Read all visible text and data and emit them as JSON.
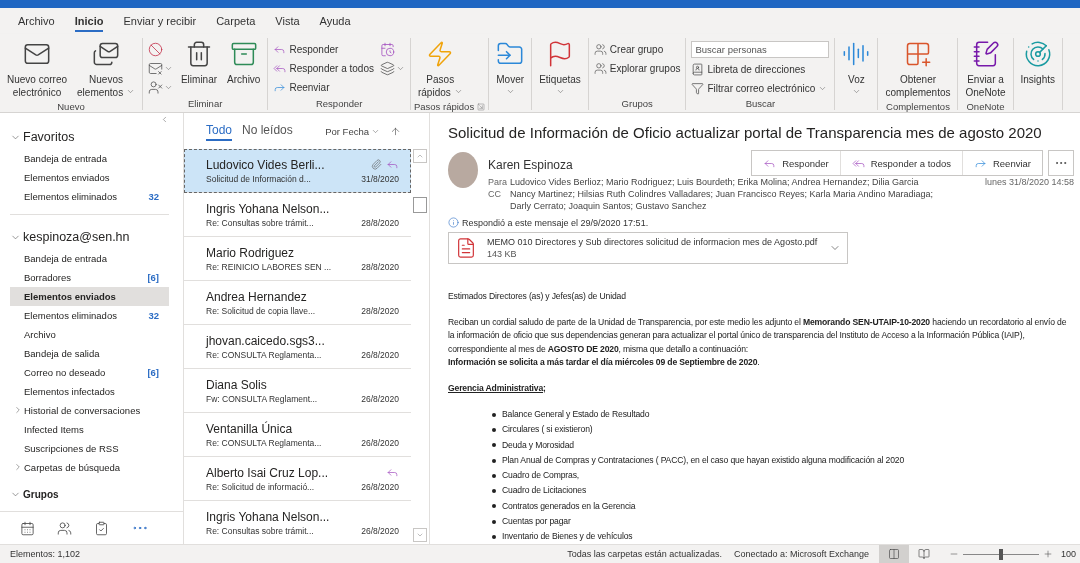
{
  "menu_tabs": [
    {
      "label": "Archivo",
      "selected": false
    },
    {
      "label": "Inicio",
      "selected": true
    },
    {
      "label": "Enviar y recibir",
      "selected": false
    },
    {
      "label": "Carpeta",
      "selected": false
    },
    {
      "label": "Vista",
      "selected": false
    },
    {
      "label": "Ayuda",
      "selected": false
    }
  ],
  "ribbon": [
    {
      "label": "Nuevo",
      "items": [
        {
          "kind": "large",
          "lines": [
            "Nuevo correo",
            "electrónico"
          ],
          "dropdown": false
        },
        {
          "kind": "large",
          "lines": [
            "Nuevos",
            "elementos"
          ],
          "dropdown": true
        }
      ]
    },
    {
      "label": "Eliminar",
      "items": [
        {
          "kind": "icon",
          "dropdown": false
        },
        {
          "kind": "icon",
          "dropdown": true
        },
        {
          "kind": "icon",
          "dropdown": true
        },
        {
          "kind": "large",
          "lines": [
            "Eliminar"
          ],
          "dropdown": false
        },
        {
          "kind": "large",
          "lines": [
            "Archivo"
          ],
          "dropdown": false
        }
      ]
    },
    {
      "label": "Responder",
      "items": [
        {
          "kind": "small",
          "label": "Responder",
          "dropdown": false
        },
        {
          "kind": "small",
          "label": "Responder a todos",
          "dropdown": false
        },
        {
          "kind": "small",
          "label": "Reenviar",
          "dropdown": false
        },
        {
          "kind": "icon",
          "dropdown": false
        },
        {
          "kind": "icon",
          "dropdown": true
        }
      ]
    },
    {
      "label": "Pasos rápidos",
      "launcher": true,
      "items": [
        {
          "kind": "large",
          "lines": [
            "Pasos",
            "rápidos"
          ],
          "dropdown": true
        }
      ]
    },
    {
      "items": [
        {
          "kind": "large",
          "lines": [
            "Mover"
          ],
          "dropdown": true
        }
      ]
    },
    {
      "items": [
        {
          "kind": "large",
          "lines": [
            "Etiquetas"
          ],
          "dropdown": true
        }
      ]
    },
    {
      "label": "Grupos",
      "items": [
        {
          "kind": "small",
          "label": "Crear grupo",
          "dropdown": false
        },
        {
          "kind": "small",
          "label": "Explorar grupos",
          "dropdown": false
        }
      ]
    },
    {
      "label": "Buscar",
      "items": [
        {
          "kind": "field",
          "placeholder": "Buscar personas"
        },
        {
          "kind": "small",
          "label": "Libreta de direcciones",
          "dropdown": false
        },
        {
          "kind": "small",
          "label": "Filtrar correo electrónico",
          "dropdown": true
        }
      ]
    },
    {
      "items": [
        {
          "kind": "large",
          "lines": [
            "Voz"
          ],
          "dropdown": true
        }
      ]
    },
    {
      "label": "Complementos",
      "items": [
        {
          "kind": "large",
          "lines": [
            "Obtener",
            "complementos"
          ],
          "dropdown": false
        }
      ]
    },
    {
      "label": "OneNote",
      "items": [
        {
          "kind": "large",
          "lines": [
            "Enviar a",
            "OneNote"
          ],
          "dropdown": false
        }
      ]
    },
    {
      "items": [
        {
          "kind": "large",
          "lines": [
            "Insights"
          ],
          "dropdown": false
        }
      ]
    }
  ],
  "sidebar": {
    "sections": [
      {
        "kind": "favorites",
        "title": "Favoritos",
        "expanded": true,
        "items": [
          {
            "label": "Bandeja de entrada",
            "selected": false
          },
          {
            "label": "Elementos enviados",
            "selected": false
          },
          {
            "label": "Elementos eliminados",
            "count": "32",
            "selected": false
          }
        ]
      },
      {
        "kind": "account",
        "title": "kespinoza@sen.hn",
        "expanded": true,
        "items": [
          {
            "label": "Bandeja de entrada",
            "selected": false
          },
          {
            "label": "Borradores",
            "count": "[6]",
            "selected": false
          },
          {
            "label": "Elementos enviados",
            "selected": true
          },
          {
            "label": "Elementos eliminados",
            "count": "32",
            "selected": false
          },
          {
            "label": "Archivo",
            "selected": false
          },
          {
            "label": "Bandeja de salida",
            "selected": false
          },
          {
            "label": "Correo no deseado",
            "count": "[6]",
            "selected": false
          },
          {
            "label": "Elementos infectados",
            "selected": false
          },
          {
            "label": "Historial de conversaciones",
            "expanded": false,
            "selected": false
          },
          {
            "label": "Infected Items",
            "selected": false
          },
          {
            "label": "Suscripciones de RSS",
            "selected": false
          },
          {
            "label": "Carpetas de búsqueda",
            "expanded": false,
            "selected": false
          }
        ]
      },
      {
        "kind": "groups",
        "title": "Grupos",
        "expanded": true
      }
    ]
  },
  "message_list": {
    "tabs": [
      {
        "label": "Todo",
        "selected": true
      },
      {
        "label": "No leídos",
        "selected": false
      }
    ],
    "sort": "Por Fecha",
    "messages": [
      {
        "sender": "Ludovico Vides Berli...",
        "subject": "Solicitud de Información d...",
        "date": "31/8/2020",
        "selected": true,
        "attachment": true,
        "replied": true
      },
      {
        "sender": "Ingris Yohana Nelson...",
        "subject": "Re: Consultas sobre trámit...",
        "date": "28/8/2020",
        "selected": false,
        "attachment": false,
        "replied": false
      },
      {
        "sender": "Mario Rodriguez",
        "subject": "Re: REINICIO LABORES SEN ...",
        "date": "28/8/2020",
        "selected": false,
        "attachment": false,
        "replied": false
      },
      {
        "sender": "Andrea Hernandez",
        "subject": "Re: Solicitud de copia llave...",
        "date": "28/8/2020",
        "selected": false,
        "attachment": false,
        "replied": false
      },
      {
        "sender": "jhovan.caicedo.sgs3...",
        "subject": "Re: CONSULTA Reglamenta...",
        "date": "26/8/2020",
        "selected": false,
        "attachment": false,
        "replied": false
      },
      {
        "sender": "Diana Solis",
        "subject": "Fw: CONSULTA Reglament...",
        "date": "26/8/2020",
        "selected": false,
        "attachment": false,
        "replied": false
      },
      {
        "sender": "Ventanilla Única",
        "subject": "Re: CONSULTA Reglamenta...",
        "date": "26/8/2020",
        "selected": false,
        "attachment": false,
        "replied": false
      },
      {
        "sender": "Alberto Isai Cruz Lop...",
        "subject": "Re: Solicitud de informació...",
        "date": "26/8/2020",
        "selected": false,
        "attachment": false,
        "replied": true
      },
      {
        "sender": "Ingris Yohana Nelson...",
        "subject": "Re: Consultas sobre trámit...",
        "date": "26/8/2020",
        "selected": false,
        "attachment": false,
        "replied": false
      }
    ]
  },
  "reading_pane": {
    "subject": "Solicitud de Información de Oficio actualizar portal de Transparencia mes de agosto 2020",
    "sender": "Karen Espinoza",
    "to_label": "Para",
    "to": "Ludovico Vides Berlioz; Mario Rodriguez; Luis Bourdeth; Erika Molina; Andrea Hernandez; Dilia Garcia",
    "cc_label": "CC",
    "cc": "Nancy Martinez; Hilsias Ruth Colindres Valladares; Juan Francisco Reyes; Karla Maria Andino Maradiaga; Darly Cerrato; Joaquin Santos; Gustavo Sanchez",
    "date": "lunes 31/8/2020 14:58",
    "actions": [
      {
        "label": "Responder"
      },
      {
        "label": "Responder a todos"
      },
      {
        "label": "Reenviar"
      }
    ],
    "info": "Respondió a este mensaje el 29/9/2020 17:51.",
    "attachment": {
      "name": "MEMO 010 Directores y Sub directores solicitud de informacion mes de Agosto.pdf",
      "size": "143 KB"
    },
    "body": [
      {
        "kind": "paragraph",
        "text": "Estimados Directores (as) y Jefes(as) de Unidad"
      },
      {
        "kind": "paragraph",
        "text": "Reciban un cordial saludo de parte de la Unidad de Transparencia, por este medio les adjunto el **Memorando SEN-UTAIP-10-2020** haciendo un recordatorio al envío de la información de oficio que sus dependencias generan para actualizar el portal único de transparencia del Instituto de Acceso a la Información Pública (IAIP), correspondiente al mes de **AGOSTO DE 2020**, misma que detallo a continuación:"
      },
      {
        "kind": "line",
        "text": "**Información se solicita a más tardar el día miércoles 09 de Septiembre de 2020**."
      },
      {
        "kind": "heading",
        "text": "Gerencia Administrativa;"
      },
      {
        "kind": "bullet",
        "text": "Balance General  y  Estado de Resultado"
      },
      {
        "kind": "bullet",
        "text": "Circulares ( si existieron)"
      },
      {
        "kind": "bullet",
        "text": "Deuda y Morosidad"
      },
      {
        "kind": "bullet",
        "text": "Plan Anual de Compras y Contrataciones ( PACC), en el caso que hayan existido alguna modificación al 2020"
      },
      {
        "kind": "bullet",
        "text": "Cuadro de Compras,"
      },
      {
        "kind": "bullet",
        "text": "Cuadro de Licitaciones"
      },
      {
        "kind": "bullet",
        "text": "Contratos generados en la Gerencia"
      },
      {
        "kind": "bullet",
        "text": "Cuentas por pagar"
      },
      {
        "kind": "bullet",
        "text": "Inventario de Bienes y de vehículos"
      }
    ]
  },
  "status_bar": {
    "items_count": "Elementos: 1,102",
    "sync": "Todas las carpetas están actualizadas.",
    "connection": "Conectado a: Microsoft Exchange",
    "views": [
      {
        "selected": true
      },
      {
        "selected": false
      }
    ],
    "zoom": {
      "level": 0.5,
      "reading": "100"
    }
  }
}
